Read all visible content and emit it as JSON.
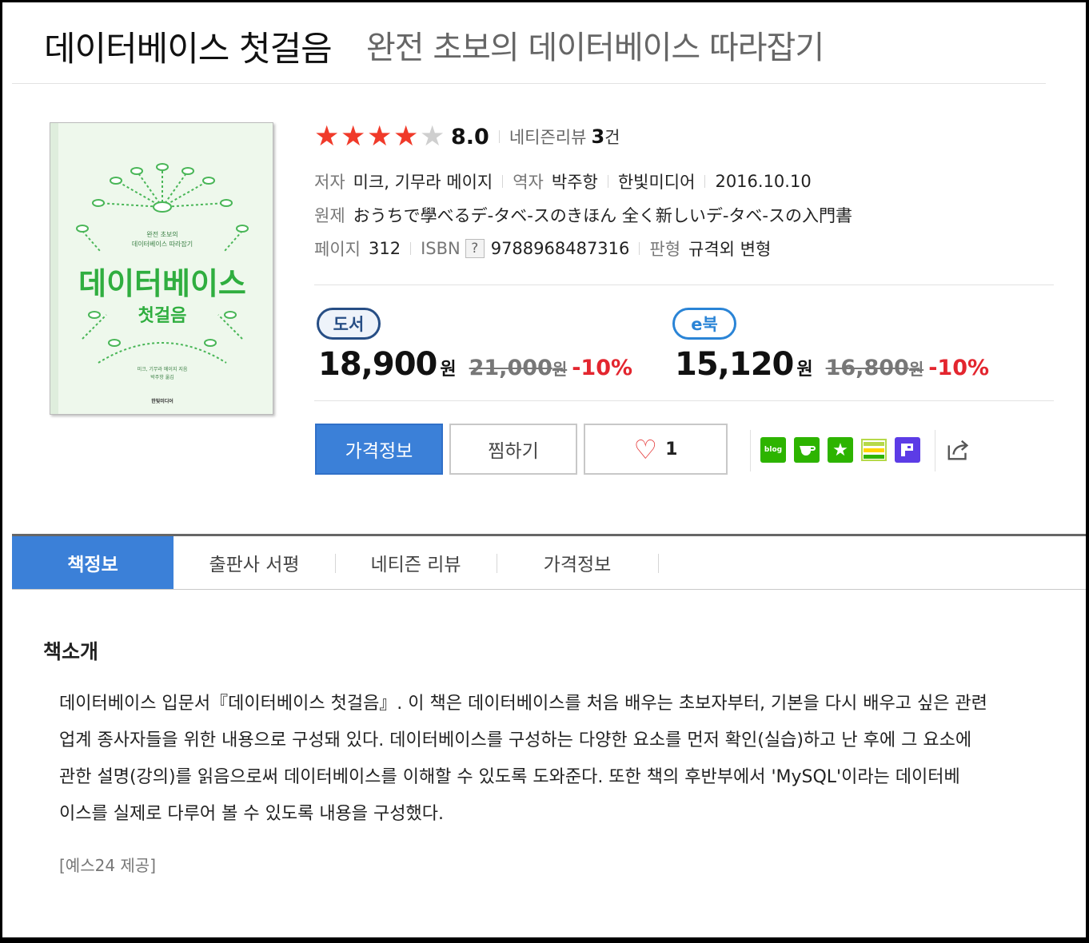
{
  "header": {
    "title": "데이터베이스 첫걸음",
    "subtitle": "완전 초보의 데이터베이스 따라잡기"
  },
  "cover": {
    "series_line1": "완전 초보의",
    "series_line2": "데이터베이스 따라잡기",
    "title_main": "데이터베이스",
    "title_sub": "첫걸음",
    "authors": "미크, 기무라 메이지 지음",
    "translator": "박주항 옮김",
    "publisher": "한빛미디어"
  },
  "rating": {
    "stars_filled": 4,
    "stars_total": 5,
    "score": "8.0",
    "review_label": "네티즌리뷰",
    "review_count": "3",
    "review_unit": "건"
  },
  "meta": {
    "author_label": "저자",
    "author": "미크, 기무라 메이지",
    "translator_label": "역자",
    "translator": "박주항",
    "publisher": "한빛미디어",
    "date": "2016.10.10",
    "original_label": "원제",
    "original_title": "おうちで學べるデ-タベ-スのきほん 全く新しいデ-タベ-スの入門書",
    "pages_label": "페이지",
    "pages": "312",
    "isbn_label": "ISBN",
    "isbn_help": "?",
    "isbn": "9788968487316",
    "format_label": "판형",
    "format": "규격외 변형"
  },
  "prices": {
    "book": {
      "badge": "도서",
      "price": "18,900",
      "unit": "원",
      "original": "21,000",
      "original_unit": "원",
      "discount": "-10%"
    },
    "ebook": {
      "badge": "e북",
      "price": "15,120",
      "unit": "원",
      "original": "16,800",
      "original_unit": "원",
      "discount": "-10%"
    }
  },
  "actions": {
    "price_info": "가격정보",
    "wishlist": "찜하기",
    "like_count": "1"
  },
  "share": {
    "blog_label": "blog",
    "icons": [
      "blog-icon",
      "cafe-icon",
      "bookmark-star-icon",
      "list-icon",
      "p-icon",
      "share-icon"
    ],
    "colors": {
      "green": "#2db400",
      "purple": "#5c3ce6"
    }
  },
  "tabs": [
    "책정보",
    "출판사 서평",
    "네티즌 리뷰",
    "가격정보"
  ],
  "intro": {
    "title": "책소개",
    "lines": [
      "데이터베이스 입문서『데이터베이스 첫걸음』. 이 책은 데이터베이스를 처음 배우는 초보자부터, 기본을 다시 배우고 싶은 관련",
      "업계 종사자들을 위한 내용으로 구성돼 있다. 데이터베이스를 구성하는 다양한 요소를 먼저 확인(실습)하고 난 후에 그 요소에",
      "관한 설명(강의)를 읽음으로써 데이터베이스를 이해할 수 있도록 도와준다. 또한 책의 후반부에서 'MySQL'이라는 데이터베",
      "이스를 실제로 다루어 볼 수 있도록 내용을 구성했다."
    ],
    "credit": "[예스24 제공]"
  },
  "colors": {
    "accent_blue": "#3b80d8",
    "star_red": "#f03a2a",
    "discount_red": "#e3262f",
    "cover_green": "#2fae3f"
  }
}
